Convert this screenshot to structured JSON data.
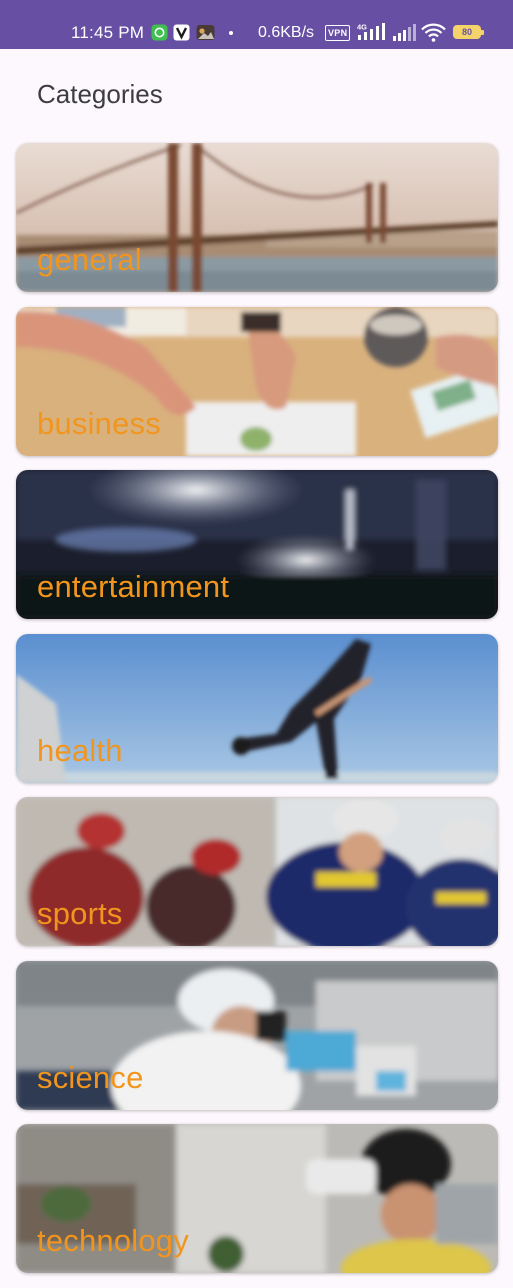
{
  "status_bar": {
    "time": "11:45 PM",
    "net_speed": "0.6KB/s",
    "vpn_label": "VPN",
    "battery_level": "80",
    "icons": [
      "chat-notification-icon",
      "v-app-icon",
      "photo-app-icon",
      "vpn-icon",
      "signal-4g-icon",
      "signal-icon",
      "wifi-icon",
      "battery-icon"
    ],
    "colors": {
      "background": "#6750a4",
      "battery": "#f5d36b"
    }
  },
  "header": {
    "title": "Categories"
  },
  "categories": [
    {
      "label": "general"
    },
    {
      "label": "business"
    },
    {
      "label": "entertainment"
    },
    {
      "label": "health"
    },
    {
      "label": "sports"
    },
    {
      "label": "science"
    },
    {
      "label": "technology"
    }
  ],
  "colors": {
    "page_background": "#fdf8fd",
    "label_text": "#f2951d",
    "title_text": "#3d3d3f"
  }
}
